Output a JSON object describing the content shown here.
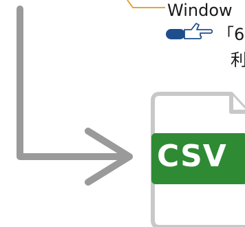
{
  "texts": {
    "line1": "Window",
    "line2": "「6",
    "line3": "利"
  },
  "csv_icon": {
    "label": "CSV",
    "badge_color": "#2e8b34",
    "file_outline_color": "#c8c8c8"
  },
  "arrow": {
    "color": "#9a9a9a"
  },
  "callout_line_color": "#e8a33a",
  "pointing_hand_color": "#1f4e8c"
}
